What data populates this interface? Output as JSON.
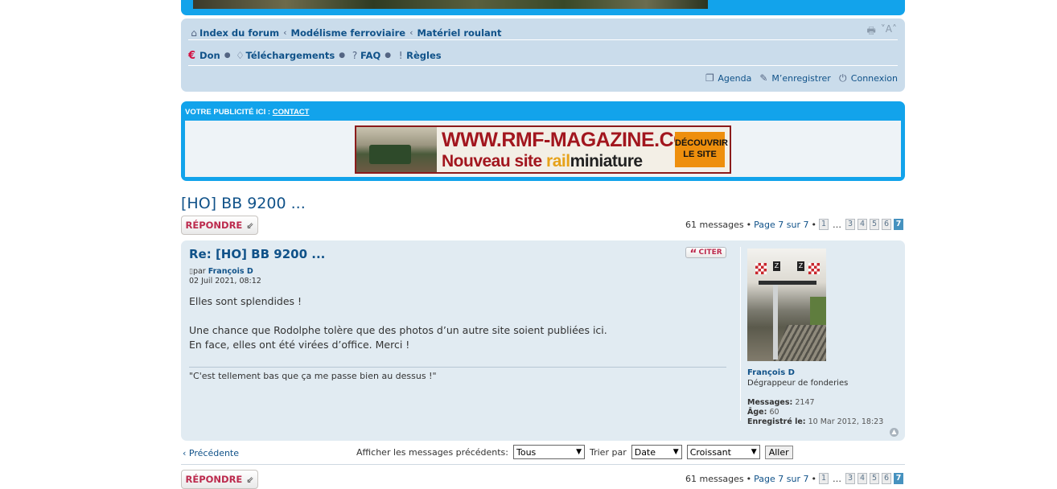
{
  "breadcrumbs": [
    "Index du forum",
    "Modélisme ferroviaire",
    "Matériel roulant"
  ],
  "nav_links": {
    "don": "Don",
    "downloads": "Téléchargements",
    "faq": "FAQ",
    "rules": "Règles",
    "euro_icon": "€"
  },
  "user_links": {
    "agenda": "Agenda",
    "register": "M’enregistrer",
    "login": "Connexion"
  },
  "tools": {
    "font_size": "A"
  },
  "ad": {
    "title": "VOTRE PUBLICITÉ ICI : ",
    "contact": "CONTACT",
    "banner_url": "WWW.RMF-MAGAZINE.COM",
    "banner_sub_1": "Nouveau site ",
    "banner_sub_rail": "rail",
    "banner_sub_mini": "miniature",
    "banner_button_1": "DÉCOUVRIR",
    "banner_button_2": "LE SITE"
  },
  "topic": {
    "title": "[HO] BB 9200 ...",
    "reply_label": "RÉPONDRE"
  },
  "pagination": {
    "summary": "61 messages",
    "bullet": "•",
    "page_label": "Page 7 sur 7",
    "pages": [
      "1",
      "3",
      "4",
      "5",
      "6",
      "7"
    ],
    "ellipsis": "…",
    "current": "7"
  },
  "post": {
    "title": "Re: [HO] BB 9200 ...",
    "quote_label": "CITER",
    "by": "par ",
    "author": "François D",
    "date": "02 Juil 2021, 08:12",
    "body": [
      "Elles sont splendides !",
      "",
      "Une chance que Rodolphe tolère que des photos d’un autre site soient publiées ici.",
      "En face, elles ont été virées d’office. Merci !"
    ],
    "signature": "\"C'est tellement bas que ça me passe bien au dessus !\""
  },
  "profile": {
    "name": "François D",
    "rank": "Dégrappeur de fonderies",
    "messages_label": "Messages:",
    "messages": "2147",
    "age_label": "Âge:",
    "age": "60",
    "registered_label": "Enregistré le:",
    "registered": "10 Mar 2012, 18:23"
  },
  "footer_nav": {
    "prev": "Précédente",
    "show_label": "Afficher les messages précédents:",
    "show_value": "Tous",
    "sort_label": "Trier par",
    "sort_value": "Date",
    "order_value": "Croissant",
    "go_label": "Aller"
  },
  "colors": {
    "header_blue": "#12a3eb",
    "nav_bg": "#cadceb",
    "post_bg": "#e1ebf2",
    "link": "#105289",
    "button_text": "#bc2a4d"
  }
}
